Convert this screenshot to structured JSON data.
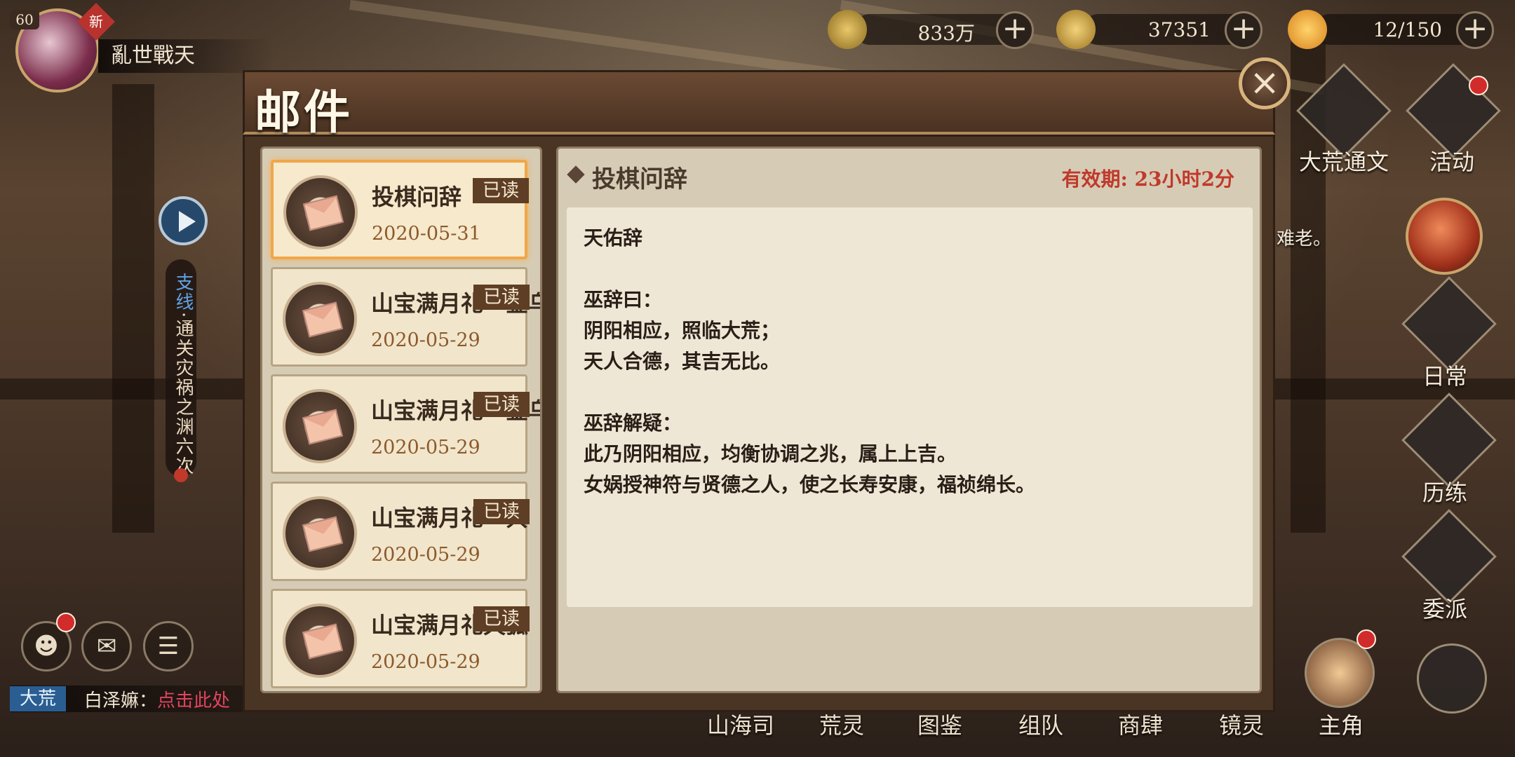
{
  "player": {
    "level": "60",
    "new_tag": "新",
    "name": "亂世戰天"
  },
  "resources": [
    {
      "icon": "coin-icon",
      "value": "833万"
    },
    {
      "icon": "gold-g-icon",
      "value": "37351"
    },
    {
      "icon": "stamina-chick-icon",
      "value": "12/150"
    }
  ],
  "plus_label": "+",
  "quest": {
    "tag": "支线",
    "text": "·通关灾祸之渊六次"
  },
  "chat": {
    "channel": "大荒",
    "sender": "白泽嫲：",
    "text": "点击此处"
  },
  "right_menu": [
    {
      "label": "大荒通文",
      "icon": "scroll-map-icon",
      "badge": false
    },
    {
      "label": "活动",
      "icon": "lantern-icon",
      "badge": true
    },
    {
      "label": "日常",
      "icon": "eye-icon",
      "badge": false
    },
    {
      "label": "历练",
      "icon": "beast-icon",
      "badge": false
    },
    {
      "label": "委派",
      "icon": "scroll-icon",
      "badge": false
    },
    {
      "label": "主角",
      "icon": "hero-portrait-icon",
      "badge": true
    }
  ],
  "side_text": "难老。",
  "bottom_nav": [
    "山海司",
    "荒灵",
    "图鉴",
    "组队",
    "商肆",
    "镜灵"
  ],
  "mail": {
    "title": "邮件",
    "close": "×",
    "items": [
      {
        "title": "投棋问辞",
        "date": "2020-05-31",
        "status": "已读"
      },
      {
        "title": "山宝满月礼—金乌",
        "date": "2020-05-29",
        "status": "已读"
      },
      {
        "title": "山宝满月礼—金乌",
        "date": "2020-05-29",
        "status": "已读"
      },
      {
        "title": "山宝满月礼—共",
        "date": "2020-05-29",
        "status": "已读"
      },
      {
        "title": "山宝满月礼天狐",
        "date": "2020-05-29",
        "status": "已读"
      }
    ],
    "detail": {
      "title": "投棋问辞",
      "expiry_label": "有效期:",
      "expiry_value": "23小时2分",
      "lines": [
        "天佑辞",
        "",
        "巫辞曰：",
        "阴阳相应，照临大荒；",
        "天人合德，其吉无比。",
        "",
        "巫辞解疑：",
        "此乃阴阳相应，均衡协调之兆，属上上吉。",
        "女娲授神符与贤德之人，使之长寿安康，福祯绵长。"
      ]
    }
  },
  "colors": {
    "accent_orange": "#f0a647",
    "expiry_red": "#c0392b",
    "read_tag": "#5e3e24"
  }
}
